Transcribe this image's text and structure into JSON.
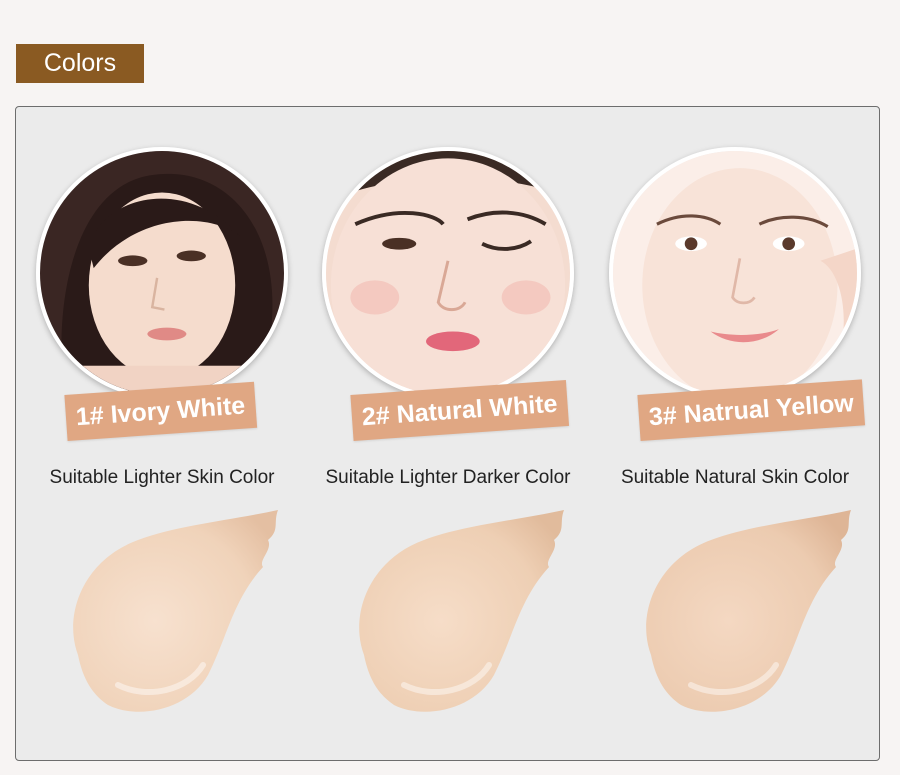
{
  "section_title": "Colors",
  "shades": [
    {
      "label": "1# Ivory White",
      "description": "Suitable Lighter Skin Color",
      "swatch_color": "#f2d6bf",
      "portrait": "woman-portrait-side-glance"
    },
    {
      "label": "2# Natural White",
      "description": "Suitable Lighter Darker Color",
      "swatch_color": "#efd1b8",
      "portrait": "woman-portrait-wink"
    },
    {
      "label": "3# Natrual Yellow",
      "description": "Suitable Natural Skin Color",
      "swatch_color": "#eccbb0",
      "portrait": "woman-portrait-smile-hand"
    }
  ],
  "colors": {
    "section_tab": "#8a5a22",
    "label_badge": "#e0a783",
    "panel_bg": "#ebebeb"
  }
}
